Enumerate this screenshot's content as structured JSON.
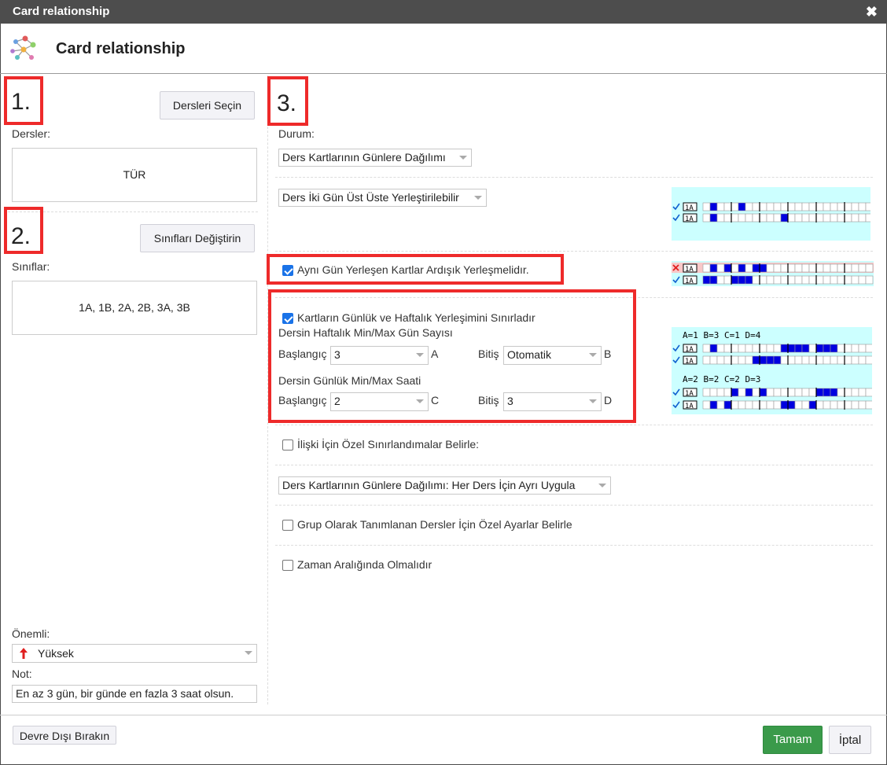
{
  "window": {
    "title": "Card relationship",
    "close_glyph": "✖"
  },
  "header": {
    "title": "Card relationship",
    "icon": "network-graph-icon"
  },
  "left": {
    "step1": "1.",
    "step2": "2.",
    "select_subjects_button": "Dersleri Seçin",
    "subjects_label": "Dersler:",
    "subjects_value": "TÜR",
    "change_classes_button": "Sınıfları Değiştirin",
    "classes_label": "Sınıflar:",
    "classes_value": "1A, 1B, 2A, 2B, 3A, 3B",
    "importance_label": "Önemli:",
    "importance_value": "Yüksek",
    "importance_icon": "red-up-arrow-icon",
    "note_label": "Not:",
    "note_value": "En az 3 gün, bir günde en fazla 3 saat olsun."
  },
  "right": {
    "step3": "3.",
    "status_label": "Durum:",
    "status_value": "Ders Kartlarının Günlere Dağılımı",
    "consecutive_days_value": "Ders İki Gün Üst Üste Yerleştirilebilir",
    "same_day_consecutive": {
      "label": "Aynı Gün Yerleşen Kartlar Ardışık Yerleşmelidır.",
      "checked": true
    },
    "limit_daily_weekly": {
      "label": "Kartların Günlük ve Haftalık Yerleşimini Sınırladır",
      "checked": true
    },
    "weekly_title": "Dersin Haftalık Min/Max Gün Sayısı",
    "start_label": "Başlangıç",
    "end_label": "Bitiş",
    "weekly_start": "3",
    "weekly_end": "Otomatik",
    "letter_a": "A",
    "letter_b": "B",
    "daily_title": "Dersin Günlük Min/Max Saati",
    "daily_start": "2",
    "daily_end": "3",
    "letter_c": "C",
    "letter_d": "D",
    "special_limits": {
      "label": "İlişki İçin Özel Sınırlandımalar Belirle:",
      "checked": false
    },
    "apply_value": "Ders Kartlarının Günlere Dağılımı: Her Ders İçin Ayrı Uygula",
    "group_settings": {
      "label": "Grup Olarak Tanımlanan Dersler İçin Özel Ayarlar Belirle",
      "checked": false
    },
    "time_range": {
      "label": "Zaman Aralığında Olmalıdır",
      "checked": false
    }
  },
  "previews": {
    "class_tag": "1A",
    "legend1": "A=1 B=3 C=1 D=4",
    "legend2": "A=2 B=2 C=2 D=3",
    "preview1": [
      [
        1,
        5
      ],
      [
        1,
        11
      ]
    ],
    "preview2_bad": [
      1,
      3,
      5,
      7,
      8
    ],
    "preview2_good": [
      0,
      1,
      4,
      5,
      6
    ],
    "preview3": [
      [
        1,
        11,
        12,
        13,
        14,
        16,
        17,
        18
      ],
      [
        7,
        8,
        9,
        10
      ],
      [
        4,
        6,
        8,
        16,
        17,
        18
      ],
      [
        1,
        3,
        11,
        12,
        15
      ]
    ],
    "colors": {
      "fill": "#0000e0",
      "bg": "#ccffff",
      "bad_bg": "#f8c8c8",
      "check": "#1060d0",
      "cross": "#e02020"
    }
  },
  "footer": {
    "disable_button": "Devre Dışı Bırakın",
    "ok_button": "Tamam",
    "cancel_button": "İptal"
  }
}
